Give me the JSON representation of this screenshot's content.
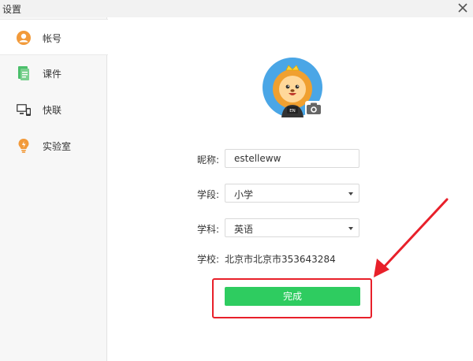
{
  "window": {
    "title": "设置"
  },
  "sidebar": {
    "items": [
      {
        "label": "帐号",
        "icon": "user-icon",
        "active": true
      },
      {
        "label": "课件",
        "icon": "courseware-icon",
        "active": false
      },
      {
        "label": "快联",
        "icon": "quick-connect-icon",
        "active": false
      },
      {
        "label": "实验室",
        "icon": "lab-bulb-icon",
        "active": false
      }
    ]
  },
  "profile": {
    "avatar_badge": "EN",
    "nickname": {
      "label": "昵称:",
      "value": "estelleww"
    },
    "stage": {
      "label": "学段:",
      "value": "小学"
    },
    "subject": {
      "label": "学科:",
      "value": "英语"
    },
    "school": {
      "label": "学校:",
      "value": "北京市北京市353643284"
    },
    "done_label": "完成"
  },
  "colors": {
    "accent_green": "#2ecc60",
    "annotation_red": "#e8202a",
    "icon_orange": "#f29a3a",
    "icon_green": "#4bbf6b",
    "avatar_bg": "#4aa6e6"
  }
}
